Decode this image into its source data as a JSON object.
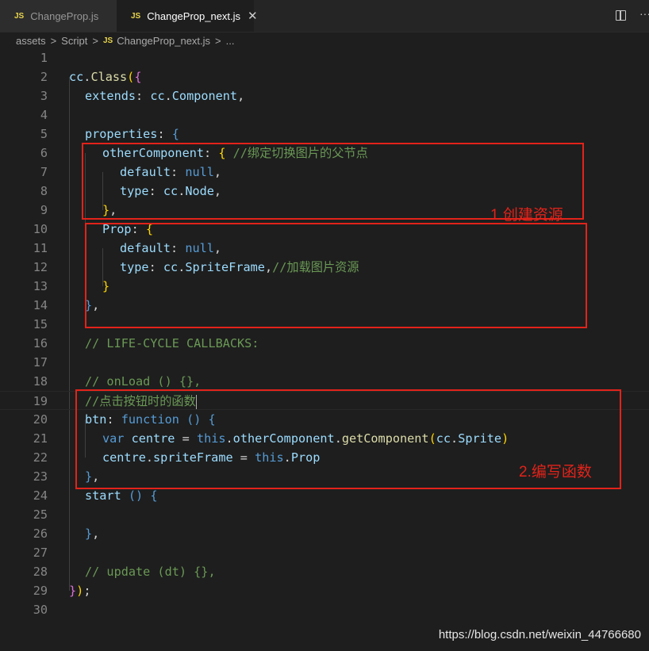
{
  "tabs": [
    {
      "badge": "JS",
      "label": "ChangeProp.js"
    },
    {
      "badge": "JS",
      "label": "ChangeProp_next.js",
      "close": "✕"
    }
  ],
  "editor_actions": {
    "split": "split-editor-icon",
    "more": "···"
  },
  "breadcrumb": {
    "items": [
      "assets",
      "Script",
      "ChangeProp_next.js",
      "..."
    ],
    "separator": ">",
    "file_badge": "JS"
  },
  "code_lines": [
    {
      "n": "1",
      "tokens": []
    },
    {
      "n": "2",
      "tokens": [
        [
          "cc",
          "p"
        ],
        [
          ".",
          "w"
        ],
        [
          "Class",
          "f"
        ],
        [
          "(",
          "b"
        ],
        [
          "{",
          "m"
        ]
      ]
    },
    {
      "n": "3",
      "tokens": [
        [
          "extends",
          "p"
        ],
        [
          ":",
          "w"
        ],
        [
          " ",
          "w"
        ],
        [
          "cc",
          "p"
        ],
        [
          ".",
          "w"
        ],
        [
          "Component",
          "p"
        ],
        [
          ",",
          "w"
        ]
      ]
    },
    {
      "n": "4",
      "tokens": []
    },
    {
      "n": "5",
      "tokens": [
        [
          "properties",
          "p"
        ],
        [
          ":",
          "w"
        ],
        [
          " ",
          "w"
        ],
        [
          "{",
          "k"
        ]
      ]
    },
    {
      "n": "6",
      "tokens": [
        [
          "otherComponent",
          "p"
        ],
        [
          ":",
          "w"
        ],
        [
          " ",
          "w"
        ],
        [
          "{",
          "b"
        ],
        [
          " ",
          "w"
        ],
        [
          "//绑定切换图片的父节点",
          "c"
        ]
      ]
    },
    {
      "n": "7",
      "tokens": [
        [
          "default",
          "p"
        ],
        [
          ":",
          "w"
        ],
        [
          " ",
          "w"
        ],
        [
          "null",
          "k"
        ],
        [
          ",",
          "w"
        ]
      ]
    },
    {
      "n": "8",
      "tokens": [
        [
          "type",
          "p"
        ],
        [
          ":",
          "w"
        ],
        [
          " ",
          "w"
        ],
        [
          "cc",
          "p"
        ],
        [
          ".",
          "w"
        ],
        [
          "Node",
          "p"
        ],
        [
          ",",
          "w"
        ]
      ]
    },
    {
      "n": "9",
      "tokens": [
        [
          "}",
          "b"
        ],
        [
          ",",
          "w"
        ]
      ]
    },
    {
      "n": "10",
      "tokens": [
        [
          "Prop",
          "p"
        ],
        [
          ":",
          "w"
        ],
        [
          " ",
          "w"
        ],
        [
          "{",
          "b"
        ]
      ]
    },
    {
      "n": "11",
      "tokens": [
        [
          "default",
          "p"
        ],
        [
          ":",
          "w"
        ],
        [
          " ",
          "w"
        ],
        [
          "null",
          "k"
        ],
        [
          ",",
          "w"
        ]
      ]
    },
    {
      "n": "12",
      "tokens": [
        [
          "type",
          "p"
        ],
        [
          ":",
          "w"
        ],
        [
          " ",
          "w"
        ],
        [
          "cc",
          "p"
        ],
        [
          ".",
          "w"
        ],
        [
          "SpriteFrame",
          "p"
        ],
        [
          ",",
          "w"
        ],
        [
          "//加载图片资源",
          "c"
        ]
      ]
    },
    {
      "n": "13",
      "tokens": [
        [
          "}",
          "b"
        ]
      ]
    },
    {
      "n": "14",
      "tokens": [
        [
          "}",
          "k"
        ],
        [
          ",",
          "w"
        ]
      ]
    },
    {
      "n": "15",
      "tokens": []
    },
    {
      "n": "16",
      "tokens": [
        [
          "// LIFE-CYCLE CALLBACKS:",
          "c"
        ]
      ]
    },
    {
      "n": "17",
      "tokens": []
    },
    {
      "n": "18",
      "tokens": [
        [
          "// onLoad () {},",
          "c"
        ]
      ]
    },
    {
      "n": "19",
      "tokens": [
        [
          "//点击按钮时的函数",
          "c"
        ]
      ]
    },
    {
      "n": "20",
      "tokens": [
        [
          "btn",
          "p"
        ],
        [
          ":",
          "w"
        ],
        [
          " ",
          "w"
        ],
        [
          "function",
          "k"
        ],
        [
          " ",
          "w"
        ],
        [
          "()",
          "k"
        ],
        [
          " ",
          "w"
        ],
        [
          "{",
          "k"
        ]
      ]
    },
    {
      "n": "21",
      "tokens": [
        [
          "var",
          "k"
        ],
        [
          " ",
          "w"
        ],
        [
          "centre",
          "p"
        ],
        [
          " ",
          "w"
        ],
        [
          "=",
          "w"
        ],
        [
          " ",
          "w"
        ],
        [
          "this",
          "k"
        ],
        [
          ".",
          "w"
        ],
        [
          "otherComponent",
          "p"
        ],
        [
          ".",
          "w"
        ],
        [
          "getComponent",
          "f"
        ],
        [
          "(",
          "b"
        ],
        [
          "cc",
          "p"
        ],
        [
          ".",
          "w"
        ],
        [
          "Sprite",
          "p"
        ],
        [
          ")",
          "b"
        ]
      ]
    },
    {
      "n": "22",
      "tokens": [
        [
          "centre",
          "p"
        ],
        [
          ".",
          "w"
        ],
        [
          "spriteFrame",
          "p"
        ],
        [
          " ",
          "w"
        ],
        [
          "=",
          "w"
        ],
        [
          " ",
          "w"
        ],
        [
          "this",
          "k"
        ],
        [
          ".",
          "w"
        ],
        [
          "Prop",
          "p"
        ]
      ]
    },
    {
      "n": "23",
      "tokens": [
        [
          "}",
          "k"
        ],
        [
          ",",
          "w"
        ]
      ]
    },
    {
      "n": "24",
      "tokens": [
        [
          "start",
          "p"
        ],
        [
          " ",
          "w"
        ],
        [
          "()",
          "k"
        ],
        [
          " ",
          "w"
        ],
        [
          "{",
          "k"
        ]
      ]
    },
    {
      "n": "25",
      "tokens": []
    },
    {
      "n": "26",
      "tokens": [
        [
          "}",
          "k"
        ],
        [
          ",",
          "w"
        ]
      ]
    },
    {
      "n": "27",
      "tokens": []
    },
    {
      "n": "28",
      "tokens": [
        [
          "// update (dt) {},",
          "c"
        ]
      ]
    },
    {
      "n": "29",
      "tokens": [
        [
          "}",
          "m"
        ],
        [
          ")",
          "b"
        ],
        [
          ";",
          "w"
        ]
      ]
    },
    {
      "n": "30",
      "tokens": []
    }
  ],
  "annotations": {
    "label_1": "1.创建资源",
    "label_2": "2.编写函数"
  },
  "watermark": "https://blog.csdn.net/weixin_44766680",
  "colors": {
    "annotation_red": "#e2231a",
    "editor_bg": "#1e1e1e",
    "line_number": "#858585",
    "comment": "#6a9955",
    "keyword": "#569cd6",
    "property": "#9cdcfe",
    "function": "#dcdcaa"
  }
}
